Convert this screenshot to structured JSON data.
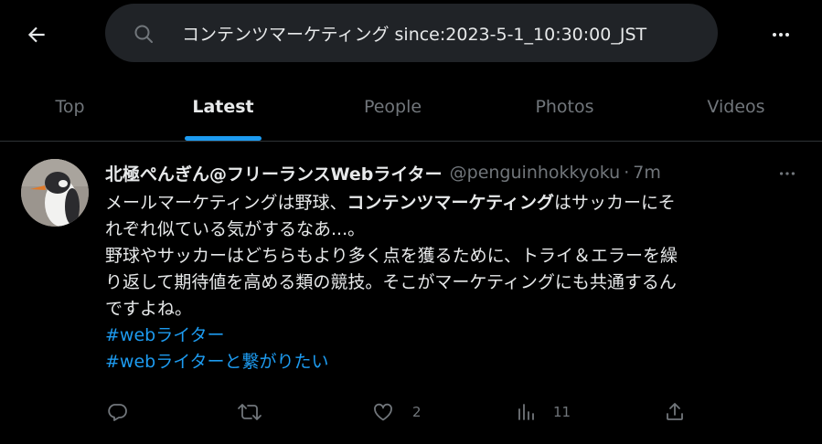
{
  "header": {
    "back_icon": "arrow-left-icon",
    "search": {
      "value": "コンテンツマーケティング since:2023-5-1_10:30:00_JST",
      "placeholder": "Search"
    },
    "more_icon": "more-horizontal-icon"
  },
  "tabs": [
    {
      "label": "Top",
      "active": false
    },
    {
      "label": "Latest",
      "active": true
    },
    {
      "label": "People",
      "active": false
    },
    {
      "label": "Photos",
      "active": false
    },
    {
      "label": "Videos",
      "active": false
    }
  ],
  "tweet": {
    "display_name": "北極ぺんぎん@フリーランスWebライター",
    "handle": "@penguinhokkyoku",
    "separator": "·",
    "time": "7m",
    "body": {
      "line1_a": "メールマーケティングは野球、",
      "line1_b": "コンテンツマーケティング",
      "line1_c": "はサッカーにそ",
      "line2": "れぞれ似ている気がするなあ...。",
      "line3": "野球やサッカーはどちらもより多く点を獲るために、トライ＆エラーを繰",
      "line4": "り返して期待値を高める類の競技。そこがマーケティングにも共通するん",
      "line5": "ですよね。",
      "hashtags": [
        "#webライター",
        "#webライターと繋がりたい"
      ]
    },
    "actions": {
      "reply": {
        "icon": "reply-icon",
        "count": ""
      },
      "retweet": {
        "icon": "retweet-icon",
        "count": ""
      },
      "like": {
        "icon": "heart-icon",
        "count": "2"
      },
      "views": {
        "icon": "views-chart-icon",
        "count": "11"
      },
      "share": {
        "icon": "share-icon",
        "count": ""
      }
    }
  },
  "colors": {
    "background": "#000000",
    "accent": "#1d9bf0",
    "text_primary": "#e7e9ea",
    "text_secondary": "#71767b",
    "search_bg": "#202327",
    "divider": "#2f3336"
  }
}
